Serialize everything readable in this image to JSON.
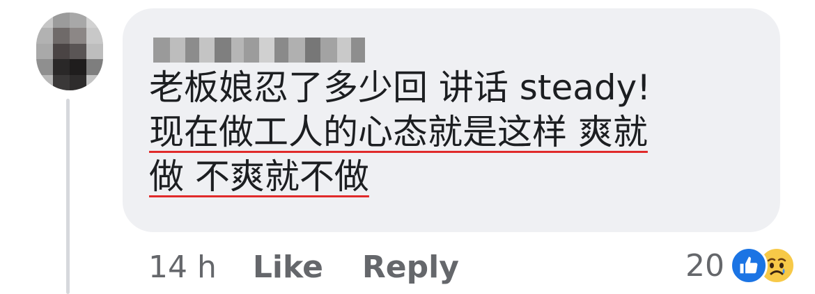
{
  "comment": {
    "author_name": "Devin Lau",
    "lines": [
      {
        "text": "老板娘忍了多少回 讲话 steady!",
        "underlined": false
      },
      {
        "text": "现在做工人的心态就是这样 爽就",
        "underlined": true
      },
      {
        "text": "做 不爽就不做",
        "underlined": true
      }
    ]
  },
  "actions": {
    "time": "14 h",
    "like_label": "Like",
    "reply_label": "Reply"
  },
  "reactions": {
    "count": "20",
    "icons": [
      "like-icon",
      "sad-icon"
    ]
  },
  "colors": {
    "bubble": "#eff0f3",
    "text": "#1c1e21",
    "meta": "#65676b",
    "underline": "#e02a2a",
    "like_blue": "#1b74e4",
    "sad_yellow": "#f7c948"
  }
}
